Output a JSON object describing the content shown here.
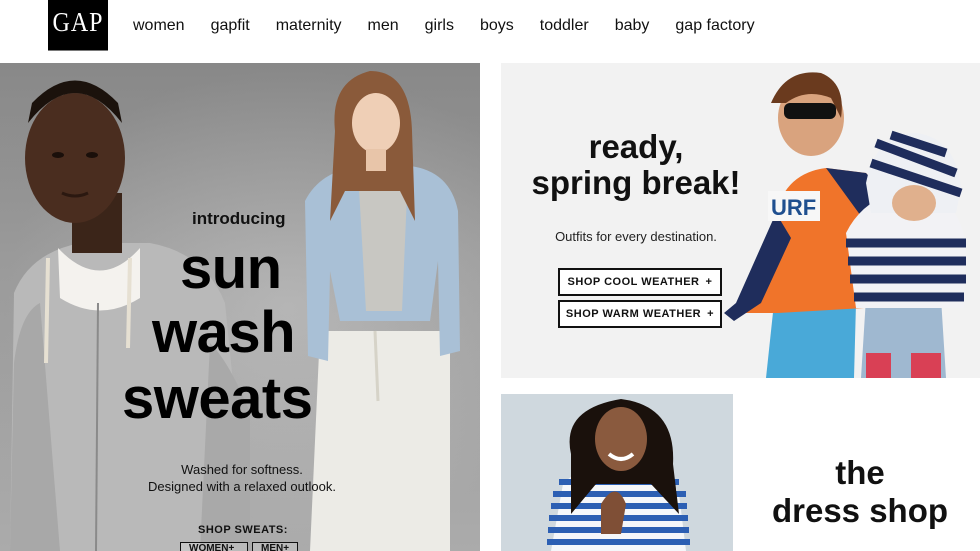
{
  "header": {
    "logo_text": "GAP",
    "nav": [
      "women",
      "gapfit",
      "maternity",
      "men",
      "girls",
      "boys",
      "toddler",
      "baby",
      "gap factory"
    ]
  },
  "hero_left": {
    "intro": "introducing",
    "line1": "sun",
    "line2": "wash",
    "line3": "sweats",
    "desc_line1": "Washed for softness.",
    "desc_line2": "Designed with a relaxed outlook.",
    "shop_label": "SHOP SWEATS:",
    "women_btn": "WOMEN+",
    "men_btn": "MEN+"
  },
  "hero_right_top": {
    "title_line1": "ready,",
    "title_line2": "spring break!",
    "subtitle": "Outfits for every destination.",
    "cool_btn": "SHOP COOL WEATHER",
    "warm_btn": "SHOP WARM WEATHER",
    "plus": "+",
    "shirt_text": "URF"
  },
  "hero_right_bottom": {
    "line1": "the",
    "line2": "dress shop"
  },
  "colors": {
    "orange": "#f0742a",
    "navy": "#1f2d5c",
    "stripe_blue": "#2c5fb3"
  }
}
